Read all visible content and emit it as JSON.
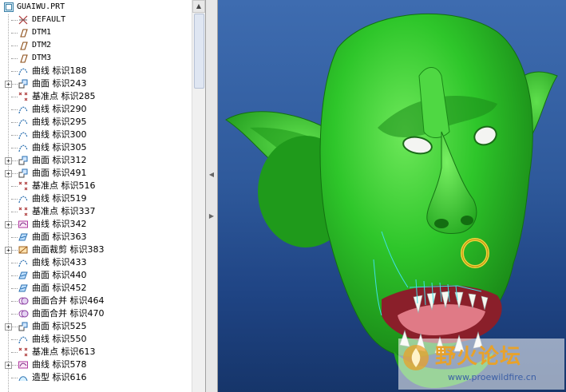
{
  "model_tree": {
    "root_label": "GUAIWU.PRT",
    "items": [
      {
        "label": "DEFAULT",
        "icon": "csys-icon",
        "expandable": false
      },
      {
        "label": "DTM1",
        "icon": "datum-plane-icon",
        "expandable": false
      },
      {
        "label": "DTM2",
        "icon": "datum-plane-icon",
        "expandable": false
      },
      {
        "label": "DTM3",
        "icon": "datum-plane-icon",
        "expandable": false
      },
      {
        "label": "曲线 标识188",
        "icon": "curve-icon",
        "expandable": false
      },
      {
        "label": "曲面 标识243",
        "icon": "surface-icon",
        "expandable": true
      },
      {
        "label": "基准点 标识285",
        "icon": "datum-point-icon",
        "expandable": false
      },
      {
        "label": "曲线 标识290",
        "icon": "curve-icon",
        "expandable": false
      },
      {
        "label": "曲线 标识295",
        "icon": "curve-icon",
        "expandable": false
      },
      {
        "label": "曲线 标识300",
        "icon": "curve-icon",
        "expandable": false
      },
      {
        "label": "曲线 标识305",
        "icon": "curve-icon",
        "expandable": false
      },
      {
        "label": "曲面 标识312",
        "icon": "surface-icon",
        "expandable": true
      },
      {
        "label": "曲面 标识491",
        "icon": "surface-icon",
        "expandable": true
      },
      {
        "label": "基准点 标识516",
        "icon": "datum-point-icon",
        "expandable": false
      },
      {
        "label": "曲线 标识519",
        "icon": "curve-icon",
        "expandable": false
      },
      {
        "label": "基准点 标识337",
        "icon": "datum-point-icon",
        "expandable": false
      },
      {
        "label": "曲线 标识342",
        "icon": "sketch-curve-icon",
        "expandable": true
      },
      {
        "label": "曲面 标识363",
        "icon": "boundary-surface-icon",
        "expandable": false
      },
      {
        "label": "曲面裁剪 标识383",
        "icon": "trim-icon",
        "expandable": true
      },
      {
        "label": "曲线 标识433",
        "icon": "curve-icon",
        "expandable": false
      },
      {
        "label": "曲面 标识440",
        "icon": "boundary-surface-icon",
        "expandable": false
      },
      {
        "label": "曲面 标识452",
        "icon": "boundary-surface-icon",
        "expandable": false
      },
      {
        "label": "曲面合并 标识464",
        "icon": "merge-icon",
        "expandable": false
      },
      {
        "label": "曲面合并 标识470",
        "icon": "merge-icon",
        "expandable": false
      },
      {
        "label": "曲面 标识525",
        "icon": "surface-icon",
        "expandable": true
      },
      {
        "label": "曲线 标识550",
        "icon": "curve-icon",
        "expandable": false
      },
      {
        "label": "基准点 标识613",
        "icon": "datum-point-icon",
        "expandable": false
      },
      {
        "label": "曲线 标识578",
        "icon": "sketch-curve-icon",
        "expandable": true
      },
      {
        "label": "造型 标识616",
        "icon": "style-icon",
        "expandable": false
      }
    ]
  },
  "viewport": {
    "background_top": "#3e6cb0",
    "background_bottom": "#16356a",
    "model_color": "#2ec62a",
    "model_shadow": "#1a8f18",
    "ring_color": "#f2d23a",
    "mouth_color": "#e07a86",
    "curve_color": "#3fe0e6"
  },
  "watermark": {
    "title": "野火论坛",
    "url": "www.proewildfire.cn"
  },
  "colors": {
    "panel_background": "#ffffff",
    "splitter": "#e7e7e7"
  }
}
